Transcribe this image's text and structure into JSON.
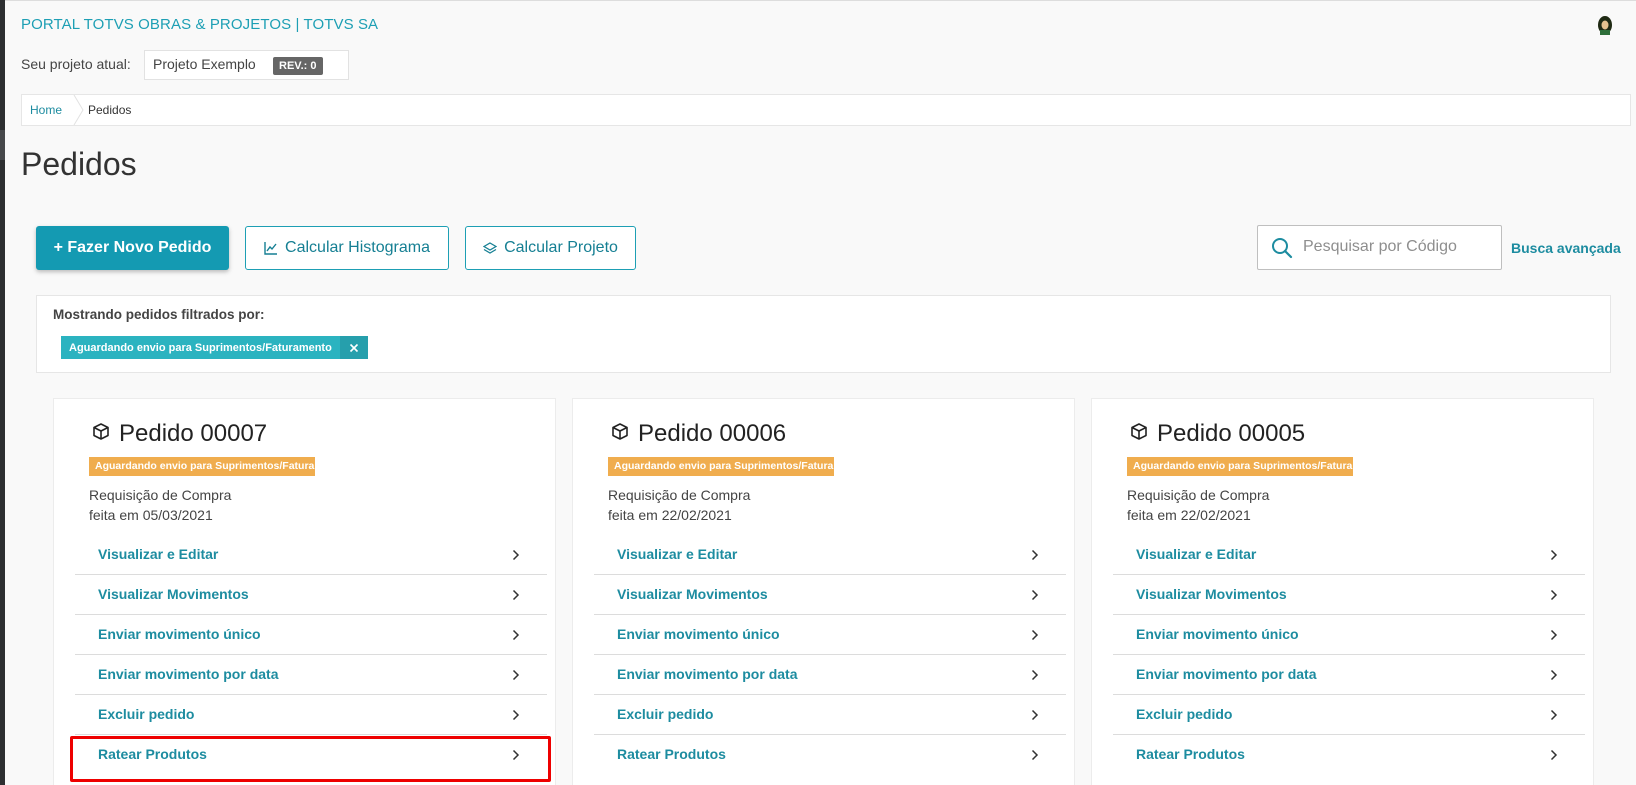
{
  "header": {
    "portal_title": "PORTAL TOTVS OBRAS & PROJETOS | TOTVS SA",
    "project_label": "Seu projeto atual:",
    "project_name": "Projeto Exemplo",
    "revision_badge": "REV.: 0"
  },
  "breadcrumb": {
    "home": "Home",
    "current": "Pedidos"
  },
  "page": {
    "title": "Pedidos"
  },
  "toolbar": {
    "new_order_label": "+ Fazer Novo Pedido",
    "histogram_label": "Calcular Histograma",
    "project_label": "Calcular Projeto",
    "search_placeholder": "Pesquisar por Código",
    "advanced_search_label": "Busca avançada"
  },
  "filters": {
    "label": "Mostrando pedidos filtrados por:",
    "chips": [
      {
        "label": "Aguardando envio para Suprimentos/Faturamento"
      }
    ]
  },
  "orders": [
    {
      "title": "Pedido 00007",
      "status": "Aguardando envio para Suprimentos/Fatura...",
      "type": "Requisição de Compra",
      "date": "feita em 05/03/2021",
      "actions": [
        "Visualizar e Editar",
        "Visualizar Movimentos",
        "Enviar movimento único",
        "Enviar movimento por data",
        "Excluir pedido",
        "Ratear Produtos"
      ]
    },
    {
      "title": "Pedido 00006",
      "status": "Aguardando envio para Suprimentos/Fatura...",
      "type": "Requisição de Compra",
      "date": "feita em 22/02/2021",
      "actions": [
        "Visualizar e Editar",
        "Visualizar Movimentos",
        "Enviar movimento único",
        "Enviar movimento por data",
        "Excluir pedido",
        "Ratear Produtos"
      ]
    },
    {
      "title": "Pedido 00005",
      "status": "Aguardando envio para Suprimentos/Fatura...",
      "type": "Requisição de Compra",
      "date": "feita em 22/02/2021",
      "actions": [
        "Visualizar e Editar",
        "Visualizar Movimentos",
        "Enviar movimento único",
        "Enviar movimento por data",
        "Excluir pedido",
        "Ratear Produtos"
      ]
    }
  ],
  "colors": {
    "accent": "#149ab2",
    "link": "#1d8ca0",
    "status_badge": "#f0ad4e",
    "filter_chip": "#2bb3c0",
    "highlight": "#ee0000"
  },
  "icons": {
    "order": "box-icon",
    "histogram": "chart-icon",
    "project": "layers-icon",
    "search": "search-icon",
    "menu_item": "chevron-right-icon",
    "chip_remove": "close-icon",
    "user": "avatar"
  }
}
